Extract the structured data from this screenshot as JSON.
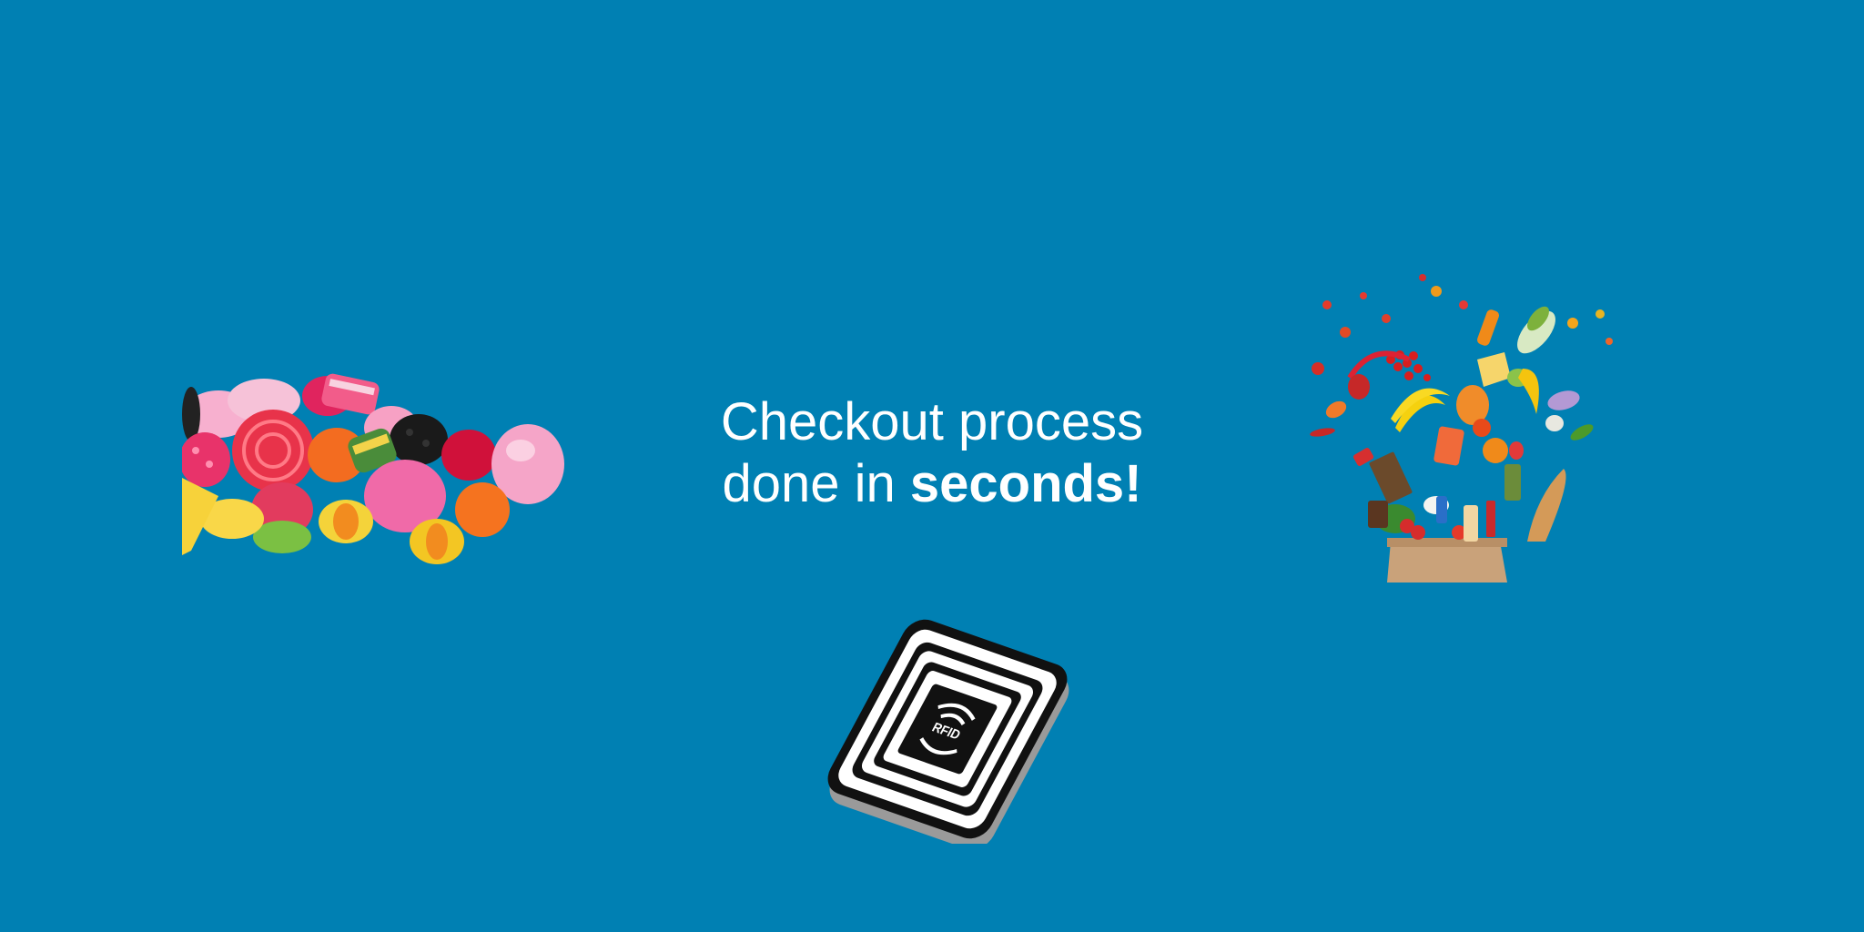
{
  "headline": {
    "line1": "Checkout process",
    "line2_prefix": "done in ",
    "line2_bold": "seconds!"
  },
  "rfid_tag": {
    "label": "RFID"
  },
  "colors": {
    "background": "#0080b3",
    "text": "#ffffff"
  },
  "images": {
    "left": "candy-pile-illustration",
    "right": "grocery-bag-illustration",
    "bottom": "rfid-tag-icon"
  }
}
